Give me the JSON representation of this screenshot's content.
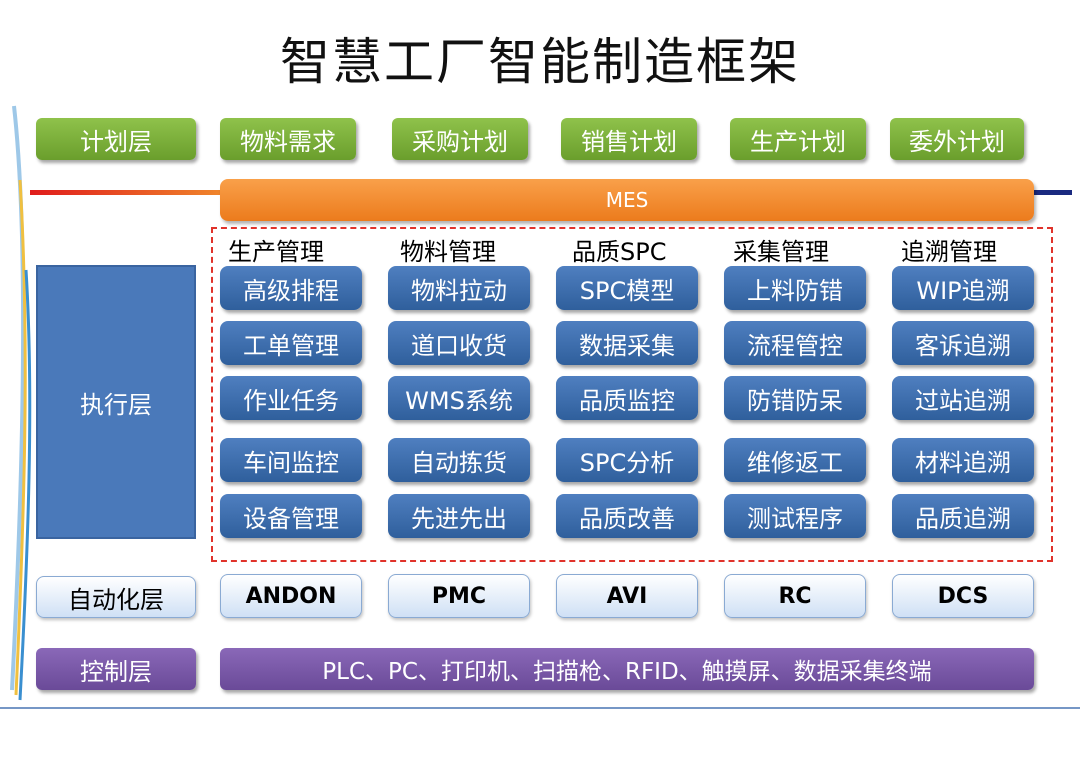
{
  "title": "智慧工厂智能制造框架",
  "plan_layer": {
    "label": "计划层",
    "items": [
      "物料需求",
      "采购计划",
      "销售计划",
      "生产计划",
      "委外计划"
    ]
  },
  "mes_label": "MES",
  "exec_layer": {
    "label": "执行层",
    "columns": [
      {
        "header": "生产管理",
        "items": [
          "高级排程",
          "工单管理",
          "作业任务",
          "车间监控",
          "设备管理"
        ]
      },
      {
        "header": "物料管理",
        "items": [
          "物料拉动",
          "道口收货",
          "WMS系统",
          "自动拣货",
          "先进先出"
        ]
      },
      {
        "header": "品质SPC",
        "items": [
          "SPC模型",
          "数据采集",
          "品质监控",
          "SPC分析",
          "品质改善"
        ]
      },
      {
        "header": "采集管理",
        "items": [
          "上料防错",
          "流程管控",
          "防错防呆",
          "维修返工",
          "测试程序"
        ]
      },
      {
        "header": "追溯管理",
        "items": [
          "WIP追溯",
          "客诉追溯",
          "过站追溯",
          "材料追溯",
          "品质追溯"
        ]
      }
    ]
  },
  "auto_layer": {
    "label": "自动化层",
    "items": [
      "ANDON",
      "PMC",
      "AVI",
      "RC",
      "DCS"
    ]
  },
  "control_layer": {
    "label": "控制层",
    "content": "PLC、PC、打印机、扫描枪、RFID、触摸屏、数据采集终端"
  },
  "colors": {
    "green": "#7ab03a",
    "blue": "#3d6cae",
    "orange": "#f08a2c",
    "purple": "#7a58a8",
    "light_blue": "#dbe7f7",
    "dashed_red": "#e0332b"
  }
}
